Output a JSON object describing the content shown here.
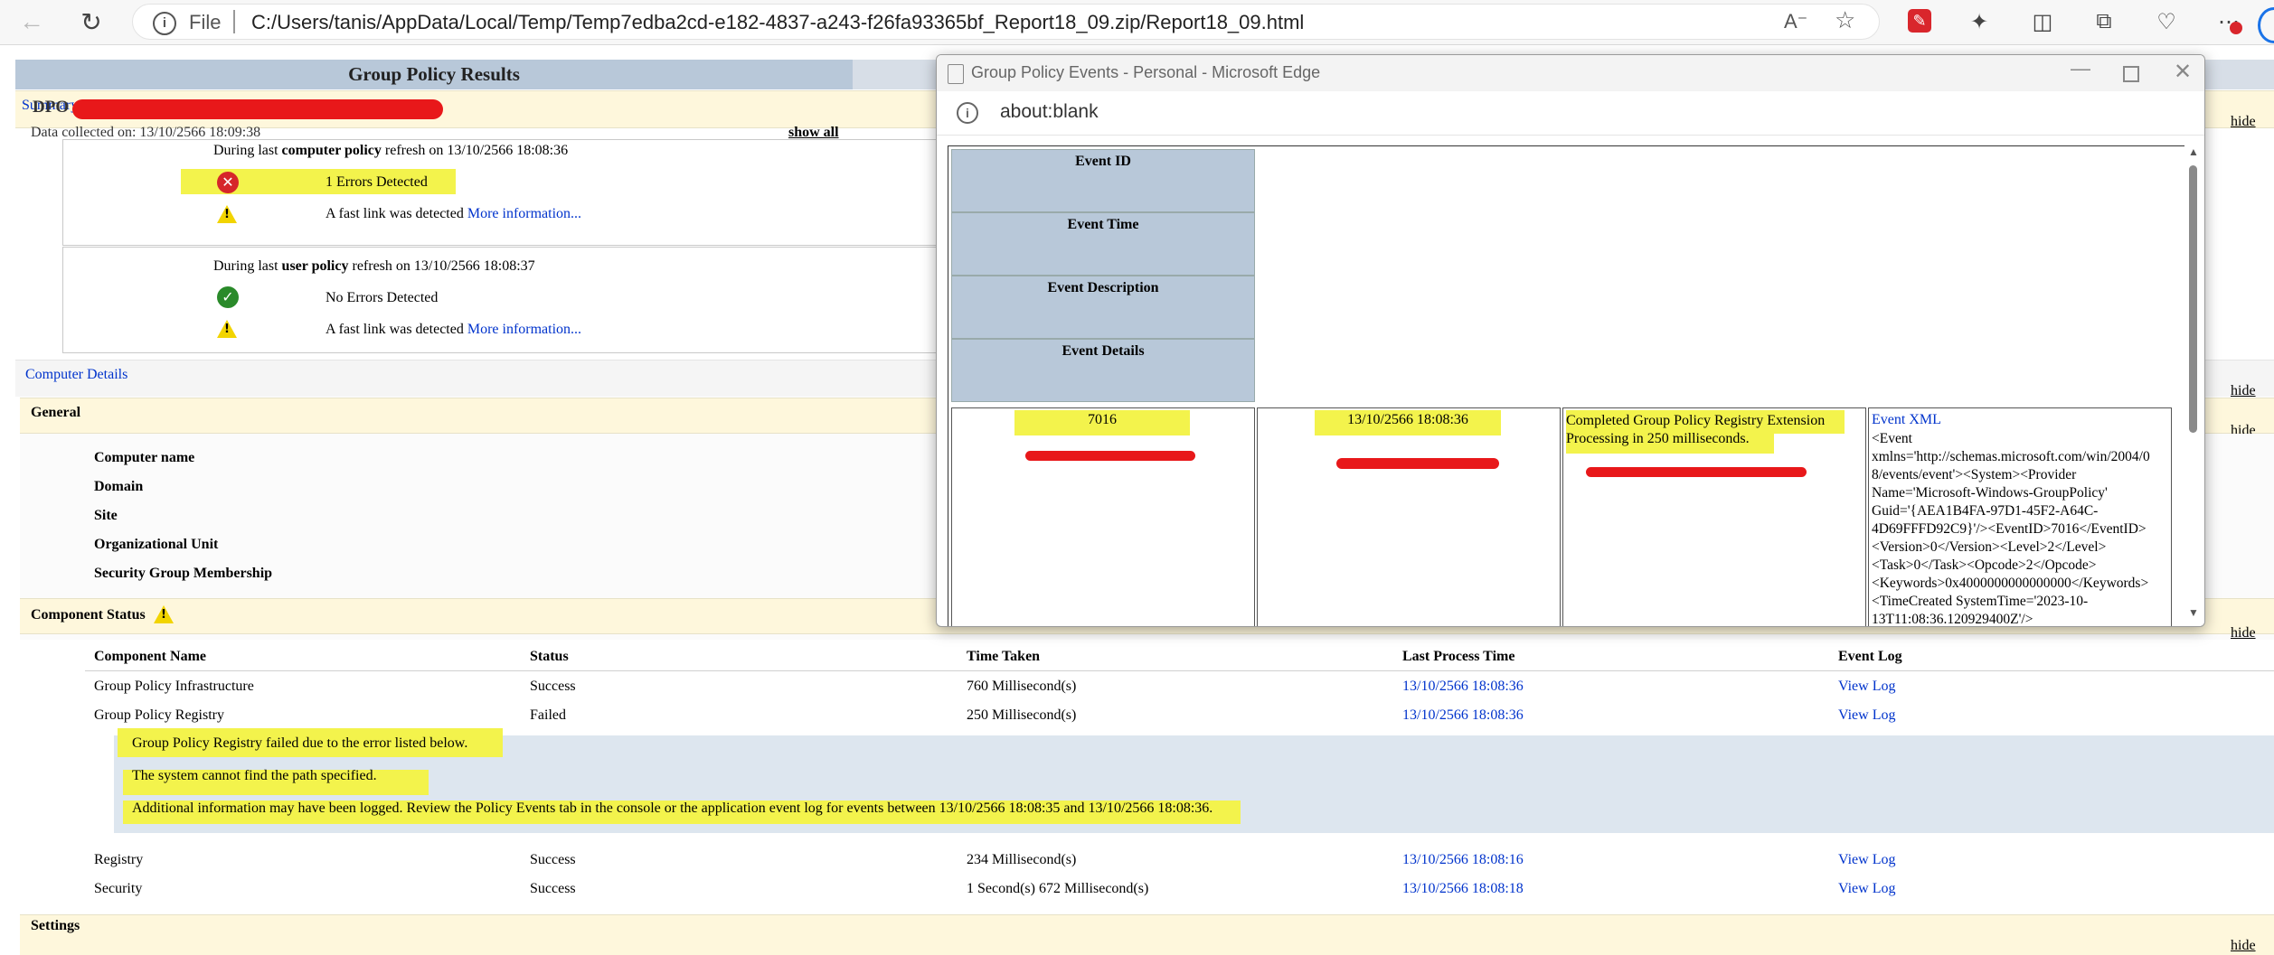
{
  "browser": {
    "file_label": "File",
    "url": "C:/Users/tanis/AppData/Local/Temp/Temp7edba2cd-e182-4837-a243-f26fa93365bf_Report18_09.zip/Report18_09.html"
  },
  "report": {
    "title": "Group Policy Results",
    "user_partial": "DPO",
    "summary_label": "Summary",
    "data_collected": "Data collected on: 13/10/2566 18:09:38",
    "show_all": "show all",
    "hide": "hide",
    "computer_refresh_pre": "During last ",
    "computer_refresh_bold": "computer policy",
    "computer_refresh_post": " refresh on 13/10/2566 18:08:36",
    "errors_detected": "1 Errors Detected",
    "fast_link": "A fast link was detected",
    "more_info": "More information...",
    "user_refresh_pre": "During last ",
    "user_refresh_bold": "user policy",
    "user_refresh_post": " refresh on 13/10/2566 18:08:37",
    "no_errors": "No Errors Detected",
    "computer_details": "Computer Details",
    "general": "General",
    "general_fields": [
      "Computer name",
      "Domain",
      "Site",
      "Organizational Unit",
      "Security Group Membership"
    ],
    "component_status": "Component Status",
    "columns": [
      "Component Name",
      "Status",
      "Time Taken",
      "Last Process Time",
      "Event Log"
    ],
    "rows": [
      {
        "name": "Group Policy Infrastructure",
        "status": "Success",
        "time": "760 Millisecond(s)",
        "last": "13/10/2566 18:08:36",
        "log": "View Log"
      },
      {
        "name": "Group Policy Registry",
        "status": "Failed",
        "time": "250 Millisecond(s)",
        "last": "13/10/2566 18:08:36",
        "log": "View Log"
      },
      {
        "name": "Registry",
        "status": "Success",
        "time": "234 Millisecond(s)",
        "last": "13/10/2566 18:08:16",
        "log": "View Log"
      },
      {
        "name": "Security",
        "status": "Success",
        "time": "1 Second(s) 672 Millisecond(s)",
        "last": "13/10/2566 18:08:18",
        "log": "View Log"
      }
    ],
    "error_lines": [
      "Group Policy Registry failed due to the error listed below.",
      "The system cannot find the path specified.",
      "Additional information may have been logged. Review the Policy Events tab in the console or the application event log for events between 13/10/2566 18:08:35 and 13/10/2566 18:08:36."
    ],
    "settings": "Settings"
  },
  "popup": {
    "title": "Group Policy Events - Personal - Microsoft Edge",
    "url": "about:blank",
    "headers": [
      "Event ID",
      "Event Time",
      "Event Description",
      "Event Details"
    ],
    "event_id": "7016",
    "event_time": "13/10/2566 18:08:36",
    "event_desc": "Completed Group Policy Registry Extension Processing in 250 milliseconds.",
    "event_xml_link": "Event XML",
    "event_xml_lines": [
      "<Event",
      "xmlns='http://schemas.microsoft.com/win/2004/0",
      "8/events/event'><System><Provider",
      "Name='Microsoft-Windows-GroupPolicy'",
      "Guid='{AEA1B4FA-97D1-45F2-A64C-",
      "4D69FFFD92C9}'/><EventID>7016</EventID>",
      "<Version>0</Version><Level>2</Level>",
      "<Task>0</Task><Opcode>2</Opcode>",
      "<Keywords>0x4000000000000000</Keywords>",
      "<TimeCreated SystemTime='2023-10-",
      "13T11:08:36.120929400Z'/>"
    ]
  },
  "colors": {
    "header_blue": "#b8c8d9",
    "section_band": "#fef7dc",
    "link": "#0033cc",
    "highlight": "#f3f34c",
    "redaction": "#e8181a"
  }
}
